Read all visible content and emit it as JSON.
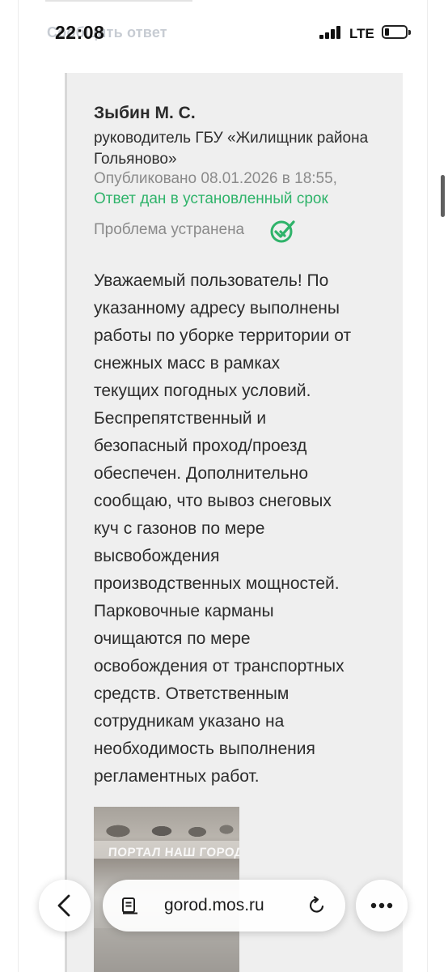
{
  "status_bar": {
    "peek_text": "Сообщить ответ",
    "time": "22:08",
    "network": "LTE"
  },
  "answer": {
    "author_name": "Зыбин М. С.",
    "author_role": "руководитель ГБУ «Жилищник района Гольяново»",
    "published": "Опубликовано 08.01.2026 в 18:55,",
    "deadline_status": "Ответ дан в установленный срок",
    "problem_status": "Проблема устранена",
    "text_lines": [
      "Уважаемый пользователь! По",
      "указанному адресу выполнены",
      "работы по уборке территории от",
      "снежных масс в рамках",
      "текущих погодных условий.",
      "Беспрепятственный и",
      "безопасный проход/проезд",
      "обеспечен. Дополнительно",
      "сообщаю, что вывоз снеговых",
      "куч с газонов по мере",
      "высвобождения",
      "производственных мощностей.",
      "Парковочные карманы",
      "очищаются по мере",
      "освобождения от транспортных",
      "средств. Ответственным",
      "сотрудникам указано на",
      "необходимость выполнения",
      "регламентных работ."
    ],
    "photo_watermark": "ПОРТАЛ НАШ ГОРОД"
  },
  "browser": {
    "url": "gorod.mos.ru"
  },
  "colors": {
    "accent_green": "#2fb36a",
    "card_background": "#efefef",
    "muted_text": "#8a8a8a"
  },
  "icons": {
    "status": [
      "cellular-signal-icon",
      "battery-icon"
    ],
    "answer": [
      "double-check-icon"
    ],
    "browser": [
      "back-arrow-icon",
      "page-icon",
      "reload-icon",
      "more-icon"
    ]
  }
}
